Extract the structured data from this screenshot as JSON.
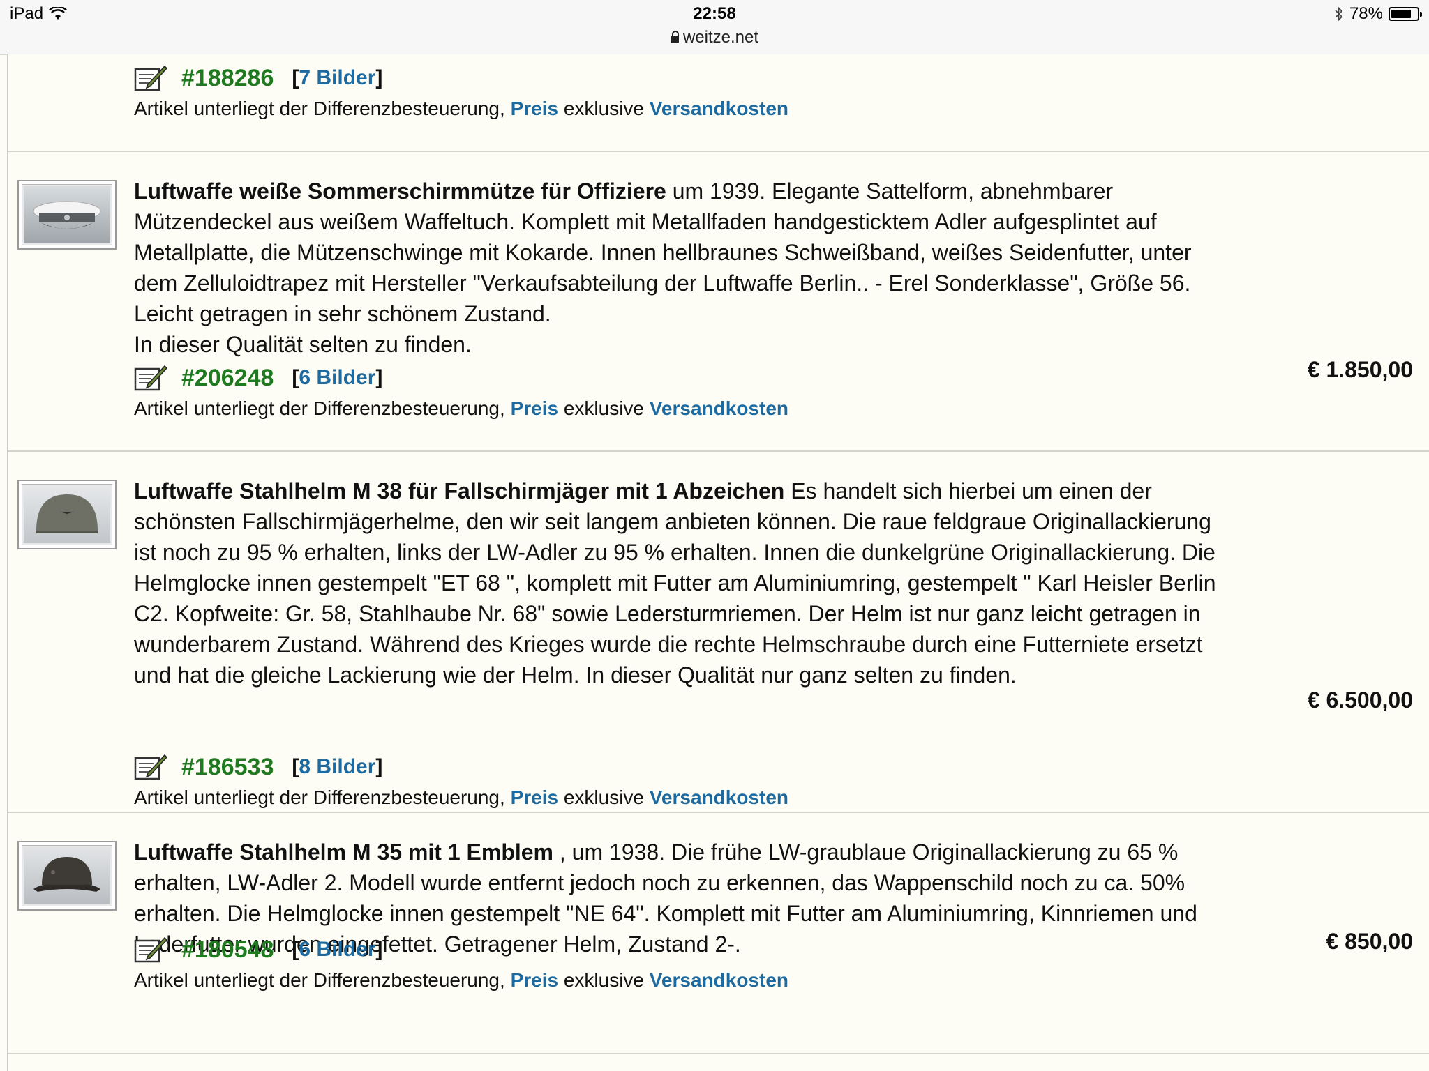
{
  "status_bar": {
    "device": "iPad",
    "time": "22:58",
    "url": "weitze.net",
    "battery_percent": "78%",
    "battery_level": 0.78
  },
  "tax_text": {
    "prefix": "Artikel unterliegt der Differenzbesteuerung,",
    "preis": "Preis",
    "middle": "exklusive",
    "versand": "Versandkosten"
  },
  "items": [
    {
      "id": "#188286",
      "bilder_open": "[",
      "bilder_label": "7 Bilder",
      "bilder_close": "]"
    },
    {
      "title": "Luftwaffe weiße Sommerschirmmütze für Offiziere",
      "description": " um 1939. Elegante Sattelform, abnehmbarer Mützendeckel aus weißem Waffeltuch. Komplett mit Metallfaden handgesticktem Adler aufgesplintet auf Metallplatte, die Mützenschwinge mit Kokarde. Innen hellbraunes Schweißband, weißes Seidenfutter, unter dem Zelluloidtrapez mit Hersteller \"Verkaufsabteilung der Luftwaffe Berlin.. - Erel Sonderklasse\", Größe 56. Leicht getragen in sehr schönem Zustand.",
      "description2": "In dieser Qualität selten zu finden.",
      "id": "#206248",
      "bilder_label": "6 Bilder",
      "price": "€ 1.850,00",
      "thumb": "white-visor-cap"
    },
    {
      "title": "Luftwaffe Stahlhelm M 38 für Fallschirmjäger mit 1 Abzeichen",
      "description": " Es handelt sich hierbei um einen der schönsten Fallschirmjägerhelme, den wir seit langem anbieten können. Die raue feldgraue Originallackierung ist noch zu 95 % erhalten, links der LW-Adler zu 95 % erhalten. Innen die dunkelgrüne Originallackierung. Die Helmglocke innen gestempelt \"ET 68 \", komplett mit Futter am Aluminiumring, gestempelt \" Karl Heisler Berlin C2. Kopfweite: Gr. 58, Stahlhaube Nr. 68\" sowie Ledersturmriemen. Der Helm ist nur ganz leicht getragen in wunderbarem Zustand. Während des Krieges wurde die rechte Helmschraube durch eine Futterniete ersetzt und hat die gleiche Lackierung wie der Helm. In dieser Qualität nur ganz selten zu finden.",
      "id": "#186533",
      "bilder_label": "8 Bilder",
      "price": "€ 6.500,00",
      "thumb": "paratrooper-helmet"
    },
    {
      "title": "Luftwaffe Stahlhelm M 35 mit 1 Emblem",
      "description": " , um 1938. Die frühe LW-graublaue Originallackierung zu 65 % erhalten, LW-Adler 2. Modell wurde entfernt jedoch noch zu erkennen, das Wappenschild noch zu ca. 50% erhalten. Die Helmglocke innen gestempelt \"NE 64\". Komplett mit Futter am Aluminiumring, Kinnriemen und Lederfutter wurden eingefettet. Getragener Helm, Zustand 2-.",
      "id": "#180548",
      "bilder_label": "6 Bilder",
      "price": "€ 850,00",
      "thumb": "m35-helmet"
    }
  ],
  "colors": {
    "link_blue": "#1c6aa0",
    "artno_green": "#1f7a1f",
    "background": "#fdfdf5"
  }
}
